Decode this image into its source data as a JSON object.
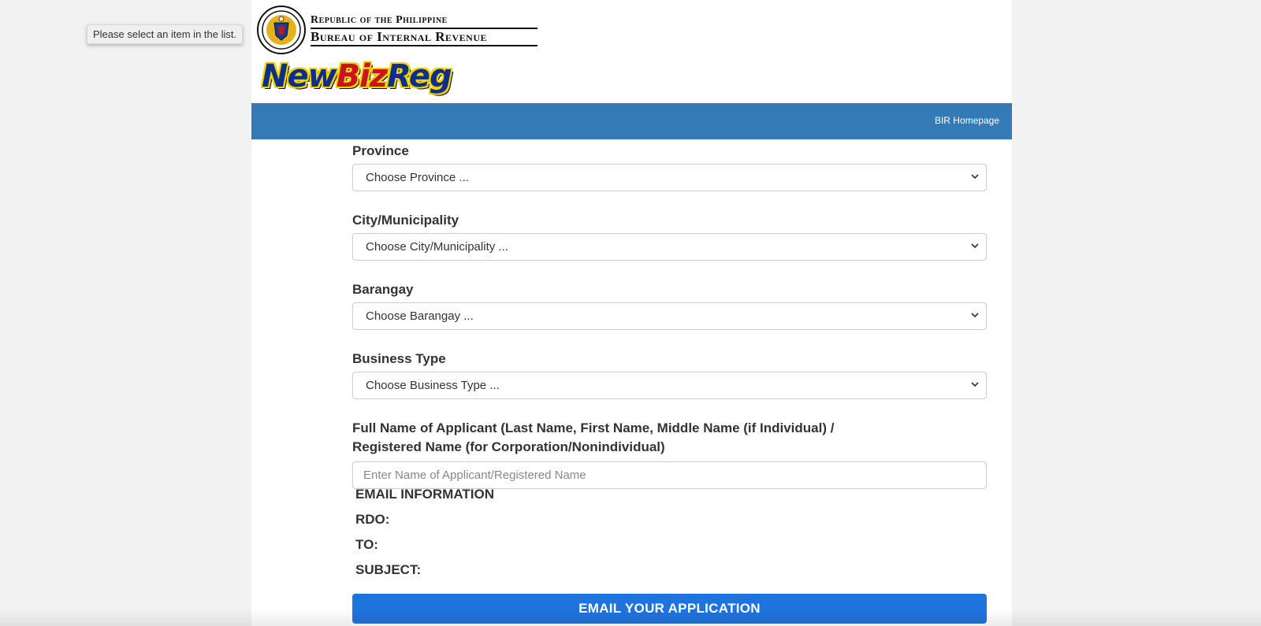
{
  "header": {
    "agency_line1": "Republic of the Philippine",
    "agency_line2": "Bureau of Internal Revenue",
    "logo_part1": "New",
    "logo_part2": "Biz",
    "logo_part3": "Reg"
  },
  "navbar": {
    "home_link": "BIR Homepage",
    "color": "#337ab7"
  },
  "tooltip": "Please select an item in the list.",
  "form": {
    "province": {
      "label": "Province",
      "value": "Choose Province ..."
    },
    "city": {
      "label": "City/Municipality",
      "value": "Choose City/Municipality ..."
    },
    "barangay": {
      "label": "Barangay",
      "value": "Choose Barangay ..."
    },
    "business_type": {
      "label": "Business Type",
      "value": "Choose Business Type ..."
    },
    "applicant": {
      "label_line1": "Full Name of Applicant (Last Name, First Name, Middle Name (if Individual) /",
      "label_line2": "Registered Name (for Corporation/Nonindividual)",
      "placeholder": "Enter Name of Applicant/Registered Name",
      "value": ""
    }
  },
  "email_info": {
    "heading": "EMAIL INFORMATION",
    "rdo_label": "RDO:",
    "to_label": "TO:",
    "subject_label": "SUBJECT:"
  },
  "submit_button": {
    "label": "EMAIL YOUR APPLICATION",
    "color": "#1f73dd"
  }
}
